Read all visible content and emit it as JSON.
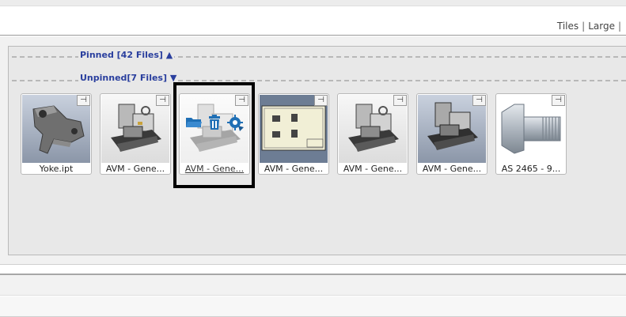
{
  "view_links": {
    "tiles": "Tiles",
    "separator": "|",
    "large": "Large"
  },
  "groups": {
    "pinned_label": "Pinned [42 Files] ▲",
    "unpinned_label": "Unpinned[7 Files] ▼"
  },
  "tiles": [
    {
      "name": "Yoke.ipt",
      "thumb": "yoke-part"
    },
    {
      "name": "AVM - Gene...",
      "thumb": "assembly"
    },
    {
      "name": "AVM - Gene...",
      "thumb": "assembly",
      "selected": true
    },
    {
      "name": "AVM - Gene...",
      "thumb": "drawing-sheet"
    },
    {
      "name": "AVM - Gene...",
      "thumb": "assembly"
    },
    {
      "name": "AVM - Gene...",
      "thumb": "assembly-dark"
    },
    {
      "name": "AS 2465 - 9...",
      "thumb": "bolt"
    }
  ],
  "pin_icon": "pushpin-icon",
  "selected_actions": [
    "folder-open-icon",
    "trash-icon",
    "gear-icon"
  ],
  "colors": {
    "link": "#2a3f9e",
    "action_blue": "#1f6fb5",
    "selection_frame": "#000000"
  }
}
